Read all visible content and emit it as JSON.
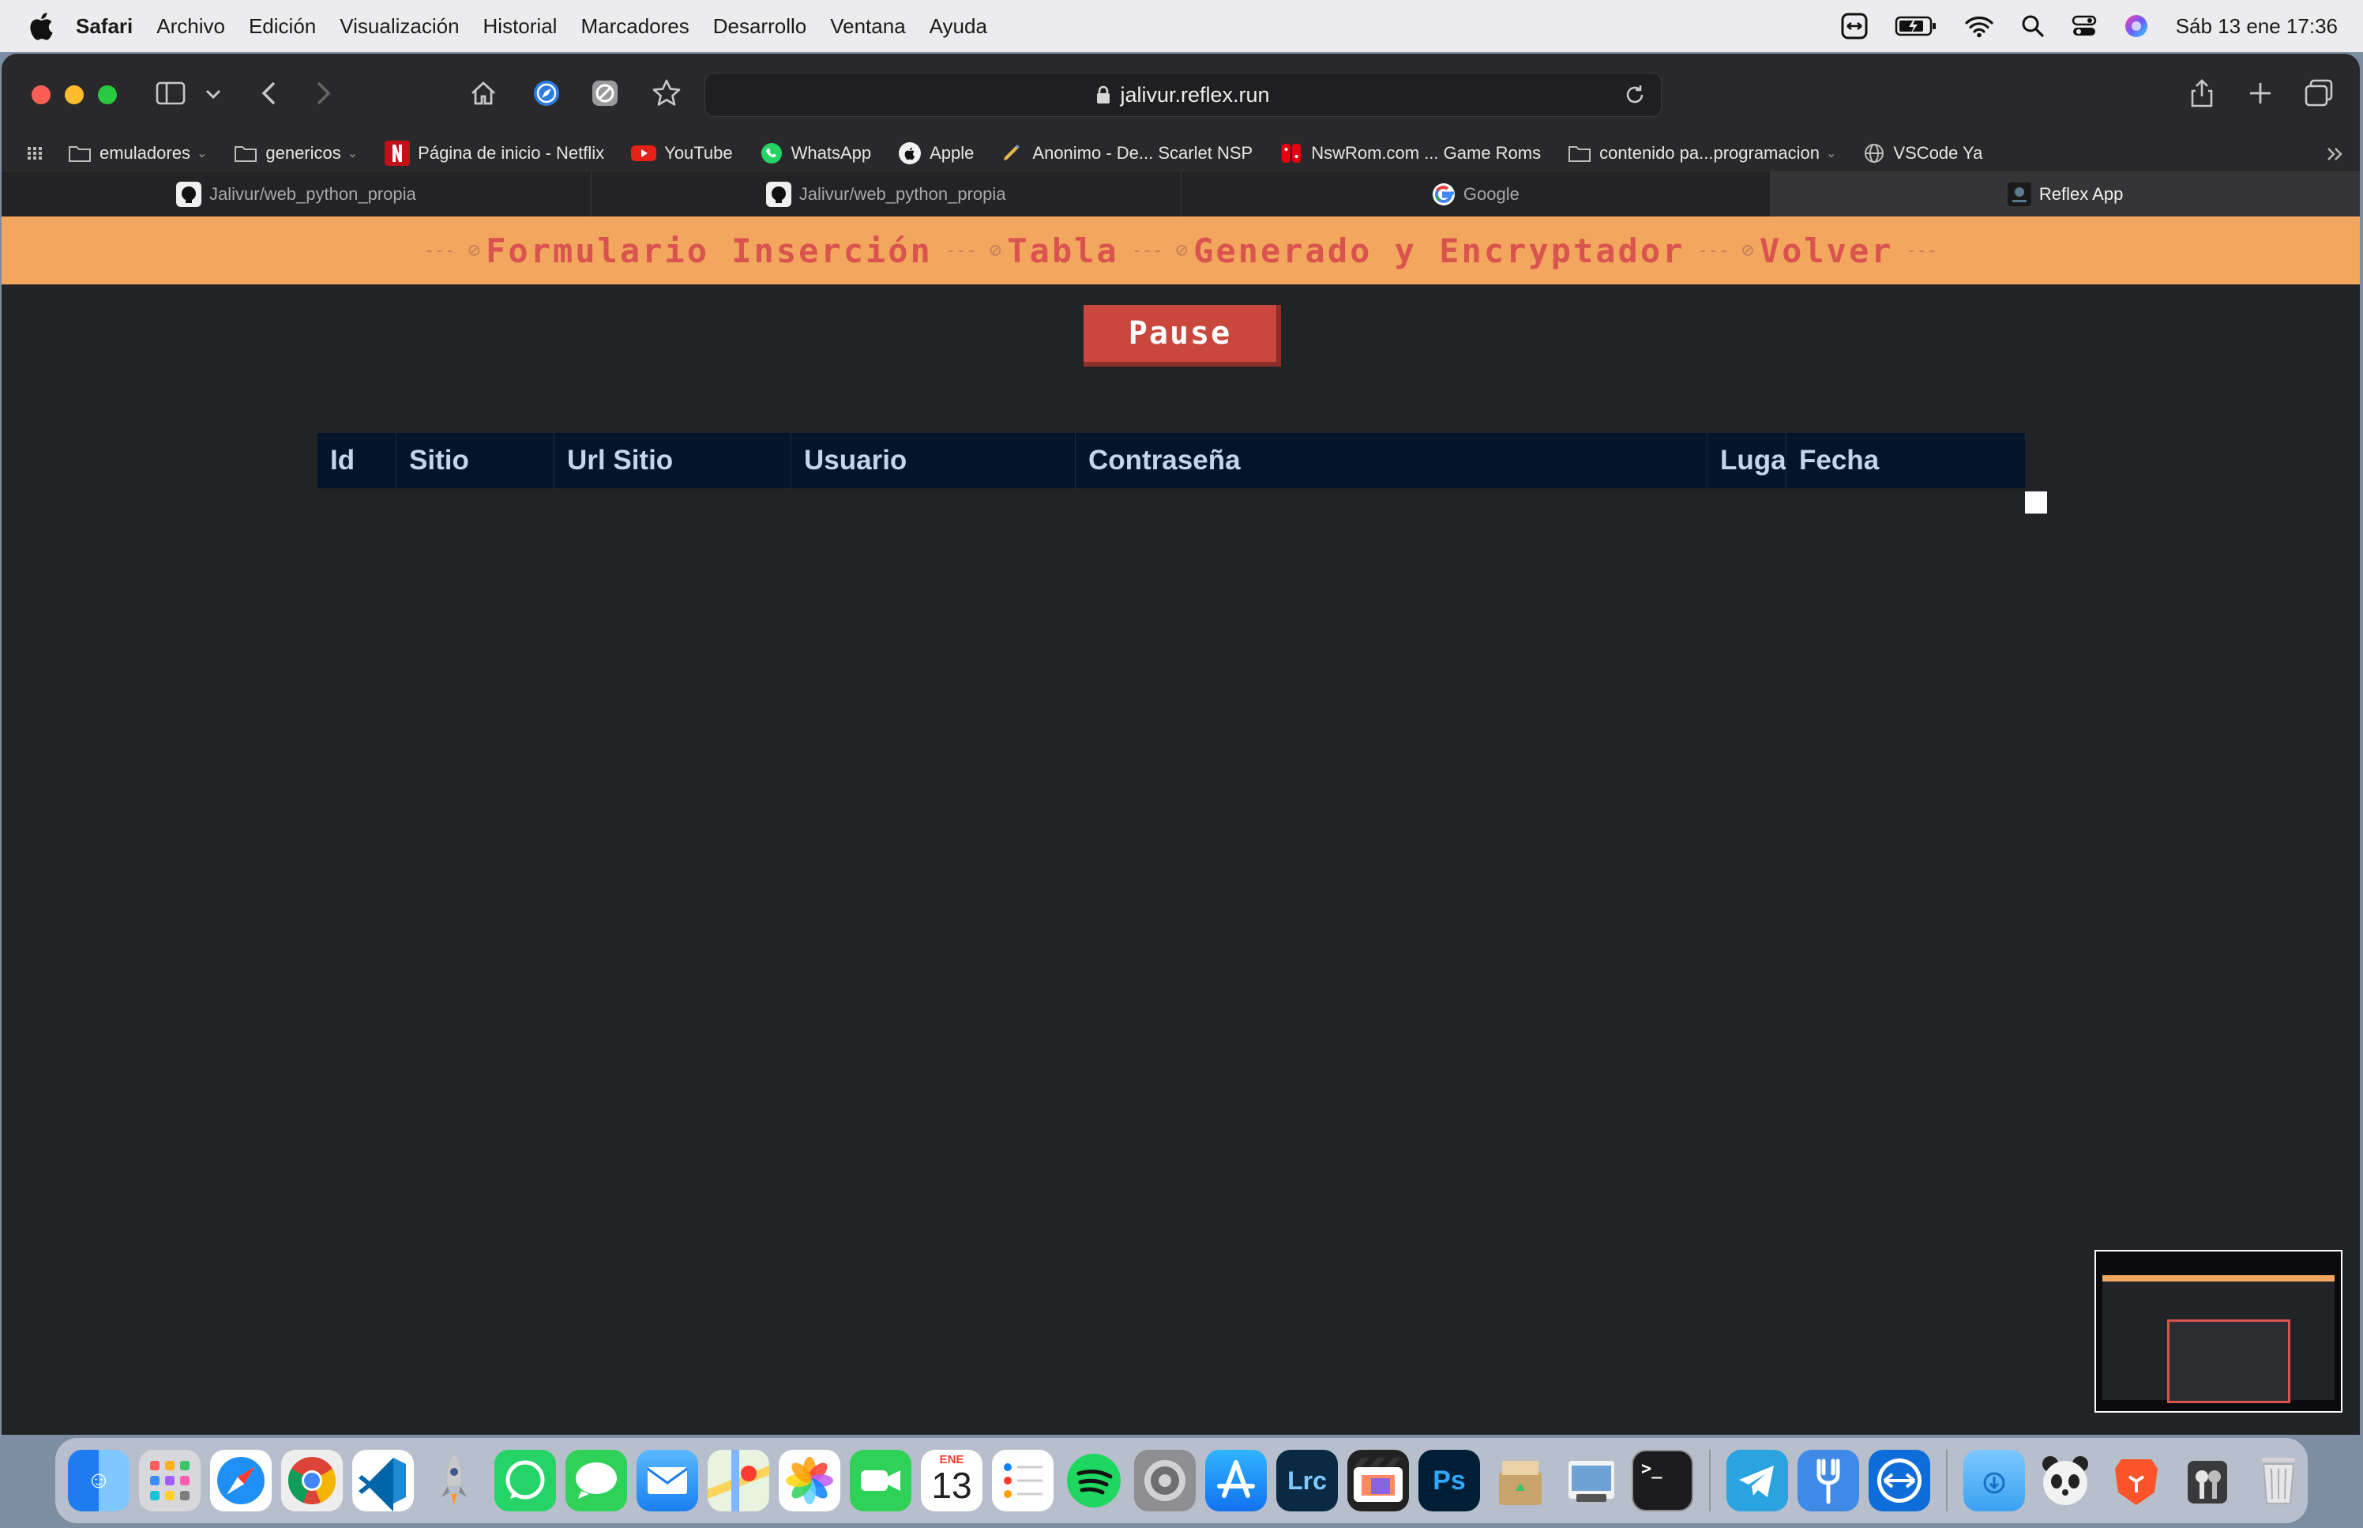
{
  "menubar": {
    "app": "Safari",
    "items": [
      "Archivo",
      "Edición",
      "Visualización",
      "Historial",
      "Marcadores",
      "Desarrollo",
      "Ventana",
      "Ayuda"
    ],
    "datetime": "Sáb 13 ene 17:36"
  },
  "browser": {
    "url": "jalivur.reflex.run",
    "favorites": [
      {
        "label": "emuladores",
        "icon": "folder-icon"
      },
      {
        "label": "genericos",
        "icon": "folder-icon"
      },
      {
        "label": "Página de inicio - Netflix",
        "icon": "netflix-icon"
      },
      {
        "label": "YouTube",
        "icon": "youtube-icon"
      },
      {
        "label": "WhatsApp",
        "icon": "whatsapp-icon"
      },
      {
        "label": "Apple",
        "icon": "apple-icon"
      },
      {
        "label": "Anonimo - De... Scarlet NSP",
        "icon": "pen-icon"
      },
      {
        "label": "NswRom.com ... Game Roms",
        "icon": "switch-icon"
      },
      {
        "label": "contenido pa...programacion",
        "icon": "folder-icon"
      },
      {
        "label": "VSCode Ya",
        "icon": "globe-icon"
      }
    ],
    "tabs": [
      {
        "label": "Jalivur/web_python_propia",
        "icon": "github-icon"
      },
      {
        "label": "Jalivur/web_python_propia",
        "icon": "github-icon"
      },
      {
        "label": "Google",
        "icon": "google-icon"
      },
      {
        "label": "Reflex App",
        "icon": "reflex-icon"
      }
    ]
  },
  "page": {
    "nav_links": [
      "Formulario Inserción",
      "Tabla",
      "Generado y Encryptador",
      "Volver"
    ],
    "pause_label": "Pause",
    "table_headers": [
      "Id",
      "Sitio",
      "Url Sitio",
      "Usuario",
      "Contraseña",
      "Luga",
      "Fecha"
    ]
  },
  "dock": {
    "apps": [
      "Finder",
      "Launchpad",
      "Safari",
      "Chrome",
      "VS Code",
      "Rocket",
      "WhatsApp",
      "Messages",
      "Mail",
      "Maps",
      "Photos",
      "FaceTime",
      "Calendar",
      "Reminders",
      "Spotify",
      "System Settings",
      "App Store",
      "Lightroom Classic",
      "Final Cut Pro",
      "Photoshop",
      "Archive Utility",
      "Preview",
      "Terminal",
      "Telegram",
      "Fork",
      "TeamViewer",
      "Downloads",
      "Panda",
      "Brave",
      "Keychain",
      "Trash"
    ],
    "calendar_month": "ENE",
    "calendar_day": "13",
    "lrc": "Lrc",
    "ps": "Ps"
  },
  "colors": {
    "nav_bg": "#f2a65e",
    "nav_text": "#d9534f",
    "pause_bg": "#c9473d",
    "table_header_bg": "#04142a",
    "page_bg": "#212327"
  }
}
